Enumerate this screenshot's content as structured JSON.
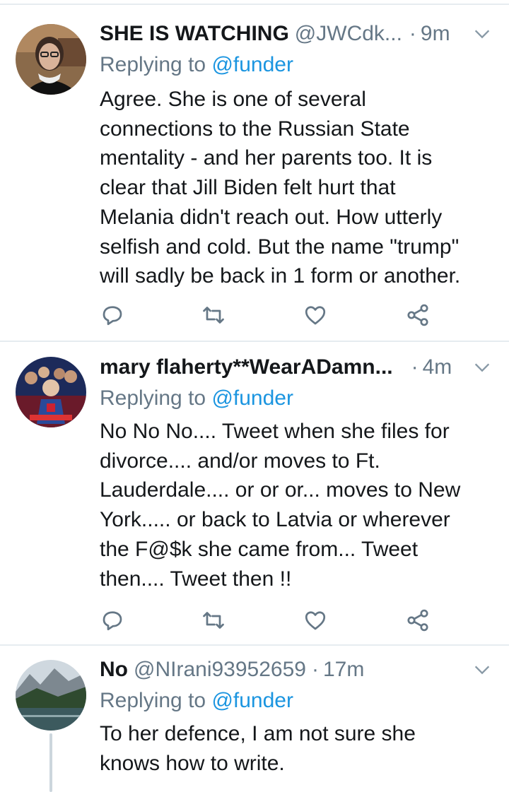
{
  "tweets": [
    {
      "name": "SHE IS WATCHING",
      "handle": "@JWCdk...",
      "separator": "·",
      "time": "9m",
      "reply_prefix": "Replying to",
      "reply_to": "@funder",
      "lines": [
        "Agree. She is one of several",
        "connections to the Russian State",
        "mentality - and her parents too. It is",
        "clear that Jill Biden felt hurt that",
        "Melania didn't reach out. How utterly",
        "selfish and cold. But the name \"trump\"",
        "will sadly be back in 1 form or another."
      ],
      "avatar": "avatar-portrait"
    },
    {
      "name": "mary flaherty**WearADamn...",
      "handle": "",
      "separator": "·",
      "time": "4m",
      "reply_prefix": "Replying to",
      "reply_to": "@funder",
      "lines": [
        "No No No.... Tweet when she files for",
        "divorce.... and/or moves to Ft.",
        "Lauderdale.... or or or... moves to New",
        "York..... or back to Latvia or wherever",
        "the F@$k she came from... Tweet",
        "then.... Tweet then !!"
      ],
      "avatar": "avatar-poster"
    },
    {
      "name": "No",
      "handle": "@NIrani93952659",
      "separator": "·",
      "time": "17m",
      "reply_prefix": "Replying to",
      "reply_to": "@funder",
      "lines": [
        "To her defence, I am not sure she",
        "knows how to write."
      ],
      "avatar": "avatar-landscape"
    }
  ],
  "icons": {
    "reply": "reply-icon",
    "retweet": "retweet-icon",
    "like": "like-icon",
    "share": "share-icon",
    "more": "chevron-down-icon"
  },
  "colors": {
    "text": "#14171a",
    "secondary": "#657786",
    "link": "#1b95e0",
    "divider": "#e6ecf0"
  }
}
